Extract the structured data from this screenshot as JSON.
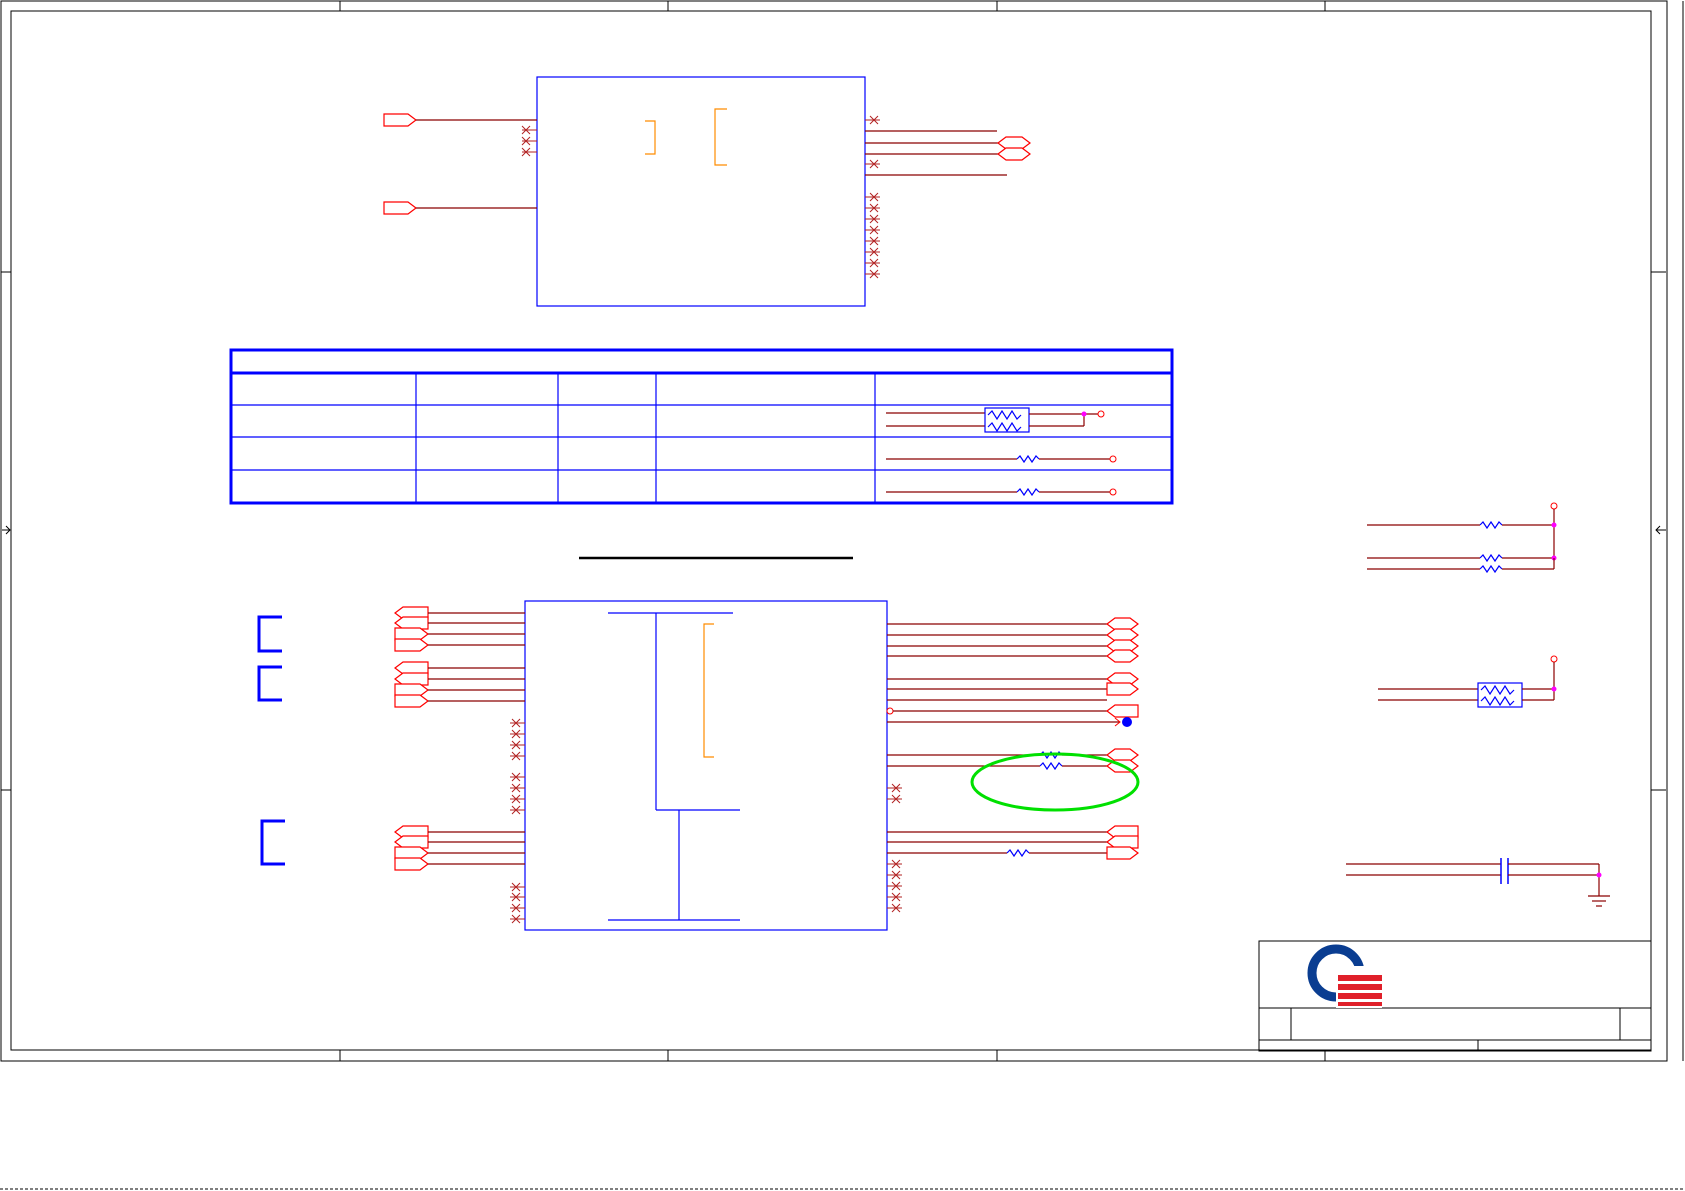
{
  "sheet": {
    "border_color": "#000000",
    "component_color": "#0000ff",
    "wire_color": "#8b0000",
    "port_color": "#ff0000",
    "bracket_color": "#ff8c00",
    "highlight_color": "#00e000",
    "junction_color": "#ff00ff"
  },
  "logo": {
    "icon": "company-logo-icon",
    "colors": {
      "ring": "#0a3d91",
      "stripes": "#e0202a"
    }
  }
}
